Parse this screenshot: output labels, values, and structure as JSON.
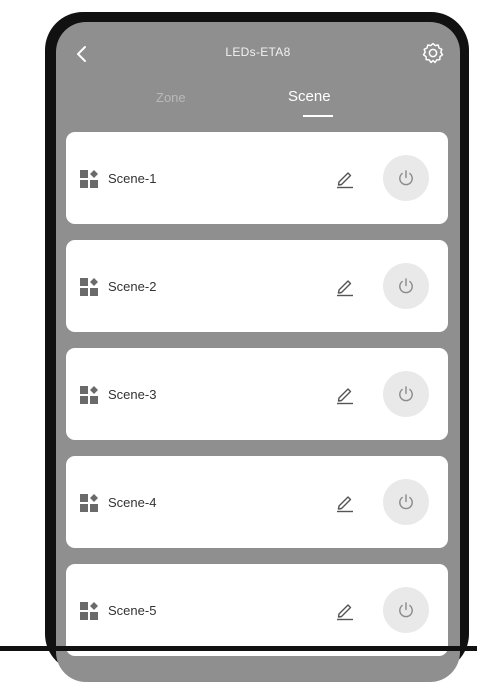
{
  "header": {
    "title": "LEDs-ETA8",
    "back_icon": "chevron-left-icon",
    "settings_icon": "settings-gear-icon"
  },
  "tabs": [
    {
      "label": "Zone",
      "active": false
    },
    {
      "label": "Scene",
      "active": true
    }
  ],
  "scenes": [
    {
      "label": "Scene-1",
      "icon": "scene-grid-icon"
    },
    {
      "label": "Scene-2",
      "icon": "scene-grid-icon"
    },
    {
      "label": "Scene-3",
      "icon": "scene-grid-icon"
    },
    {
      "label": "Scene-4",
      "icon": "scene-grid-icon"
    },
    {
      "label": "Scene-5",
      "icon": "scene-grid-icon"
    }
  ],
  "colors": {
    "screen_bg": "#8f8f8f",
    "card_bg": "#ffffff",
    "power_bg": "#e9e9e9",
    "frame": "#111111"
  }
}
